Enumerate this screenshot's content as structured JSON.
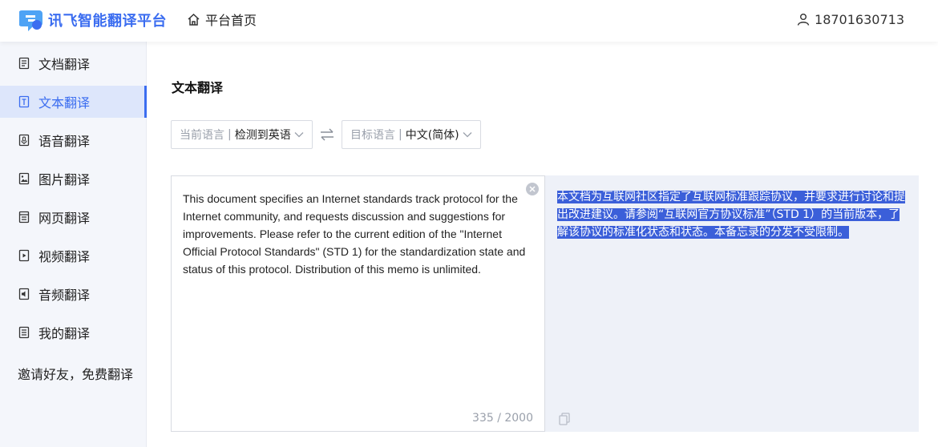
{
  "header": {
    "logo_text": "讯飞智能翻译平台",
    "home_label": "平台首页",
    "user_phone": "18701630713"
  },
  "sidebar": {
    "items": [
      {
        "label": "文档翻译",
        "icon": "document-icon"
      },
      {
        "label": "文本翻译",
        "icon": "text-icon",
        "active": true
      },
      {
        "label": "语音翻译",
        "icon": "voice-icon"
      },
      {
        "label": "图片翻译",
        "icon": "image-icon"
      },
      {
        "label": "网页翻译",
        "icon": "webpage-icon"
      },
      {
        "label": "视频翻译",
        "icon": "video-icon"
      },
      {
        "label": "音频翻译",
        "icon": "audio-icon"
      },
      {
        "label": "我的翻译",
        "icon": "my-translations-icon"
      }
    ],
    "invite_label": "邀请好友，免费翻译"
  },
  "main": {
    "title": "文本翻译",
    "source_lang": {
      "label": "当前语言",
      "separator": "|",
      "value": "检测到英语"
    },
    "target_lang": {
      "label": "目标语言",
      "separator": "|",
      "value": "中文(简体)"
    },
    "source_text": "This document specifies an Internet standards track protocol for the Internet community, and requests discussion and suggestions for improvements. Please refer to the current edition of the \"Internet Official Protocol Standards\" (STD 1) for the standardization state and status of this protocol. Distribution of this memo is unlimited.",
    "char_count": "335 / 2000",
    "translation": "本文档为互联网社区指定了互联网标准跟踪协议，并要求进行讨论和提出改进建议。请参阅“互联网官方协议标准”（STD 1）的当前版本，了解该协议的标准化状态和状态。本备忘录的分发不受限制。"
  },
  "colors": {
    "accent": "#3b6df0",
    "selection": "#3b5fd9",
    "sidebar_bg": "#f4f6fb",
    "output_bg": "#eef1f8"
  }
}
